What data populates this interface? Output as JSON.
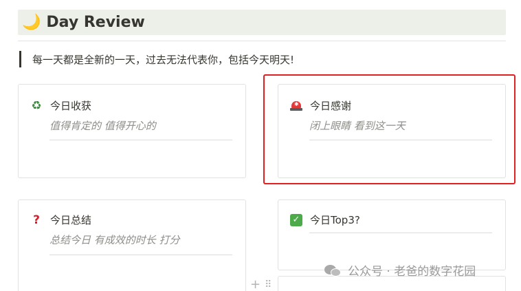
{
  "heading": {
    "icon": "crescent-moon-icon",
    "glyph": "🌙",
    "title": "Day Review",
    "bg": "#edf0e9"
  },
  "quote": {
    "text": "每一天都是全新的一天，过去无法代表你，包括今天明天!"
  },
  "cards": [
    {
      "icon": "recycle-icon",
      "glyph": "♻",
      "title": "今日收获",
      "subtitle": "值得肯定的 值得开心的"
    },
    {
      "icon": "siren-icon",
      "title": "今日感谢",
      "subtitle": "闭上眼睛 看到这一天"
    },
    {
      "icon": "question-mark-icon",
      "glyph": "?",
      "title": "今日总结",
      "subtitle": "总结今日 有成效的时长 打分"
    },
    {
      "icon": "check-box-icon",
      "glyph": "✓",
      "title": "今日Top3?",
      "subtitle": ""
    }
  ],
  "handles": {
    "plus": "+",
    "drag": "⠿"
  },
  "watermark": {
    "text": "公众号 · 老爸的数字花园",
    "icon": "wechat-icon"
  },
  "colors": {
    "highlight": "#e02020",
    "subtitle": "#8e8e8a",
    "text": "#37352f"
  }
}
